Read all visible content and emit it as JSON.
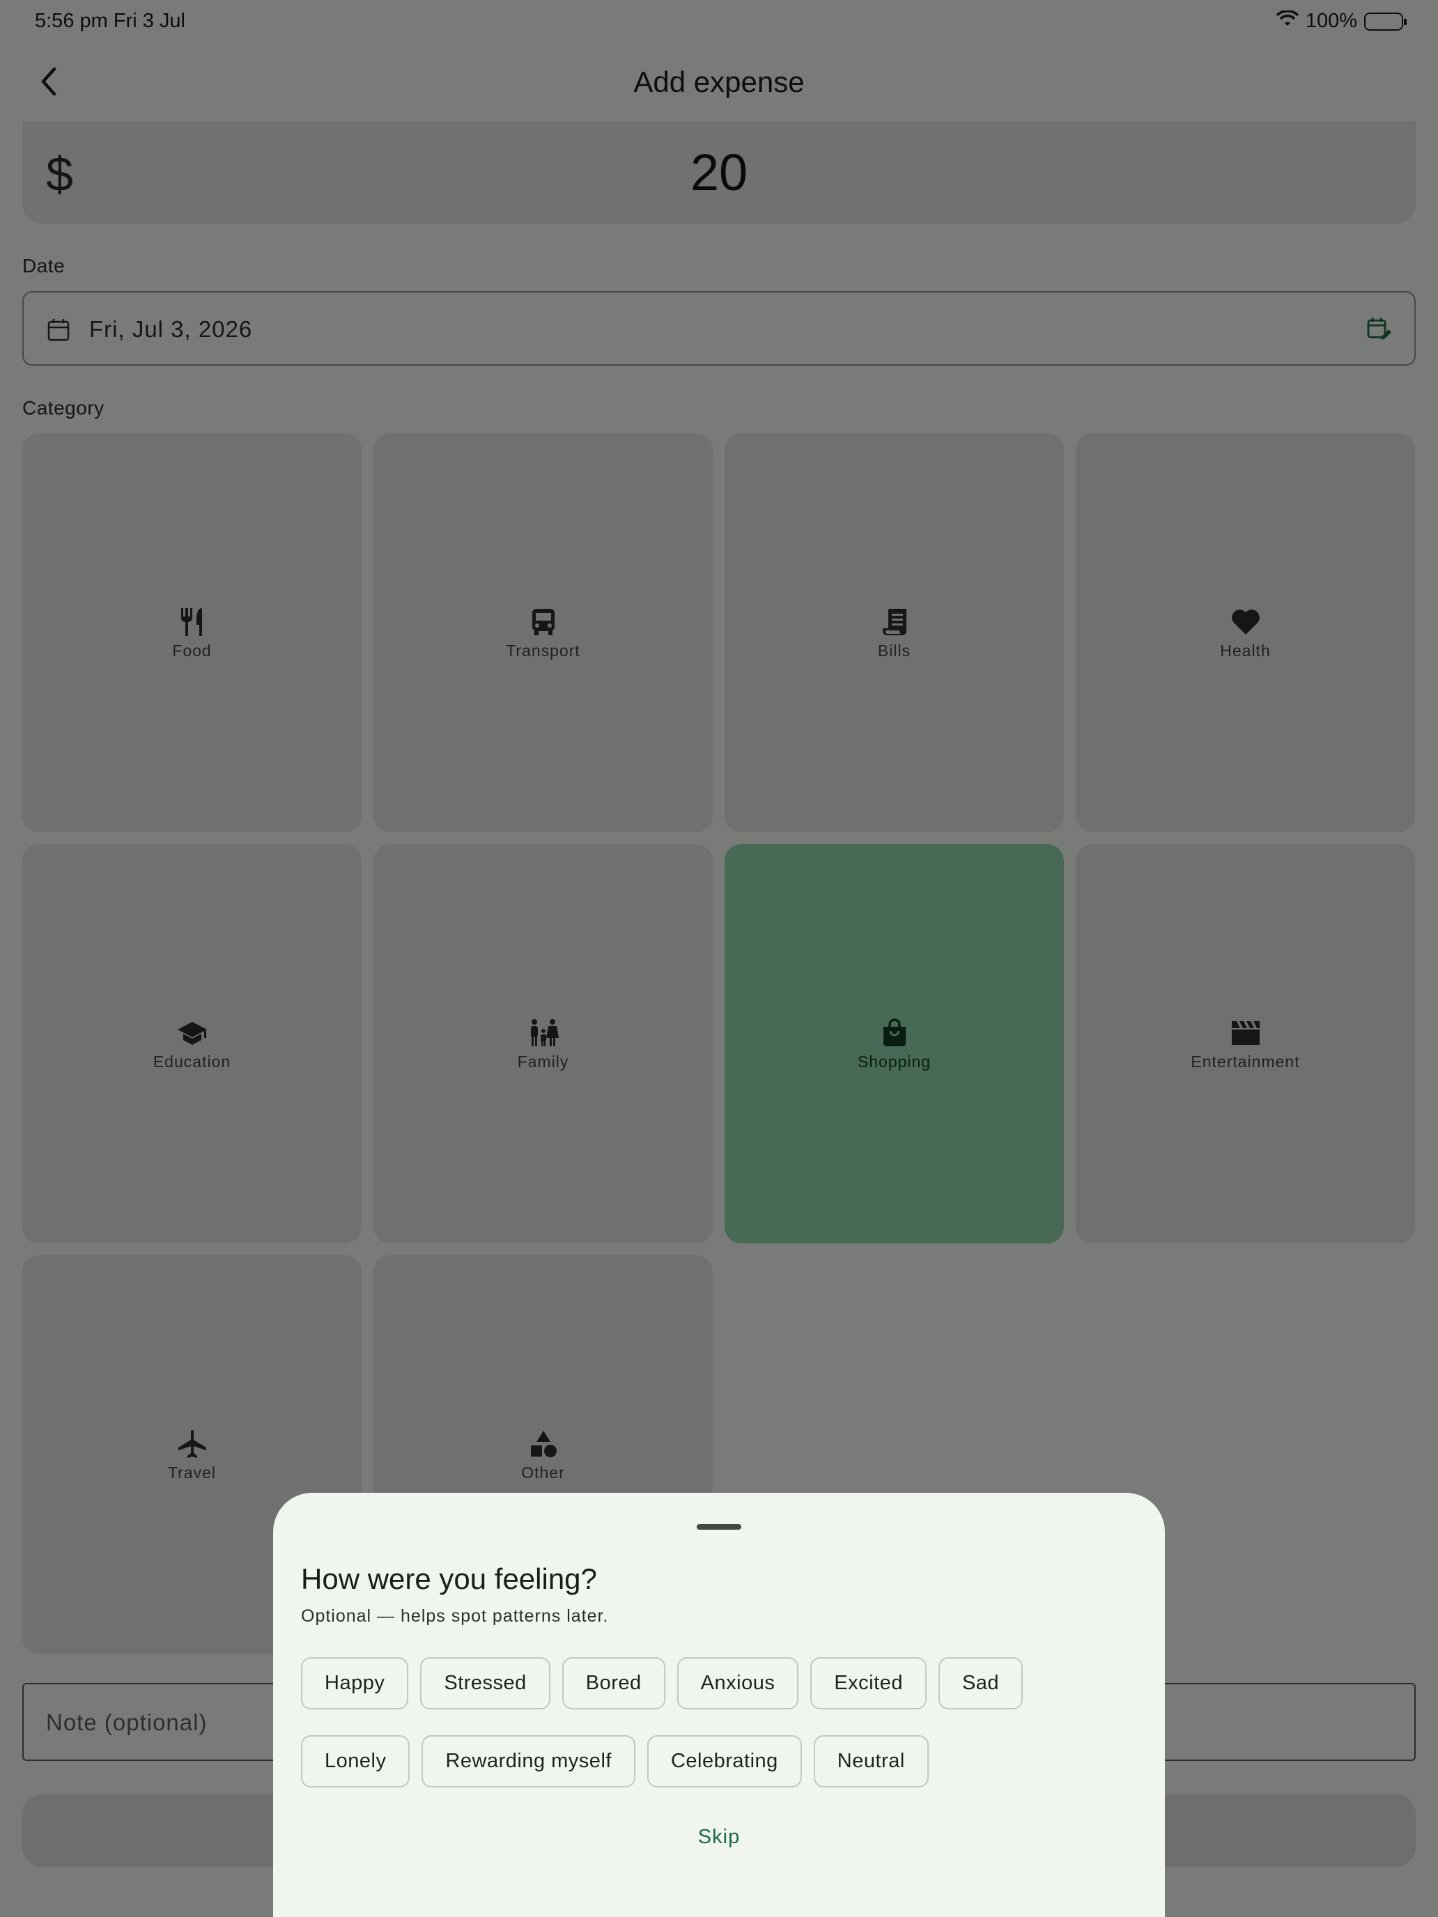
{
  "status_bar": {
    "time": "5:56 pm   Fri 3 Jul",
    "battery": "100%"
  },
  "header": {
    "title": "Add expense",
    "back_icon": "chevron-left-icon"
  },
  "amount": {
    "currency": "$",
    "value": "20"
  },
  "date": {
    "label": "Date",
    "value": "Fri, Jul 3, 2026",
    "icon": "calendar-icon",
    "action_icon": "calendar-edit-icon"
  },
  "category": {
    "label": "Category",
    "selected": "Shopping",
    "items": [
      {
        "label": "Food",
        "icon": "restaurant-icon"
      },
      {
        "label": "Transport",
        "icon": "bus-icon"
      },
      {
        "label": "Bills",
        "icon": "receipt-icon"
      },
      {
        "label": "Health",
        "icon": "heart-icon"
      },
      {
        "label": "Education",
        "icon": "graduation-cap-icon"
      },
      {
        "label": "Family",
        "icon": "family-icon"
      },
      {
        "label": "Shopping",
        "icon": "shopping-bag-icon"
      },
      {
        "label": "Entertainment",
        "icon": "clapperboard-icon"
      },
      {
        "label": "Travel",
        "icon": "airplane-icon"
      },
      {
        "label": "Other",
        "icon": "shapes-icon"
      }
    ]
  },
  "note": {
    "placeholder": "Note (optional)"
  },
  "mood_sheet": {
    "title": "How were you feeling?",
    "subtitle": "Optional — helps spot patterns later.",
    "row1": [
      "Happy",
      "Stressed",
      "Bored",
      "Anxious",
      "Excited",
      "Sad"
    ],
    "row2": [
      "Lonely",
      "Rewarding myself",
      "Celebrating",
      "Neutral"
    ],
    "skip_label": "Skip"
  },
  "colors": {
    "accent": "#1e6a44",
    "selected_tile": "#8fd3ad"
  }
}
